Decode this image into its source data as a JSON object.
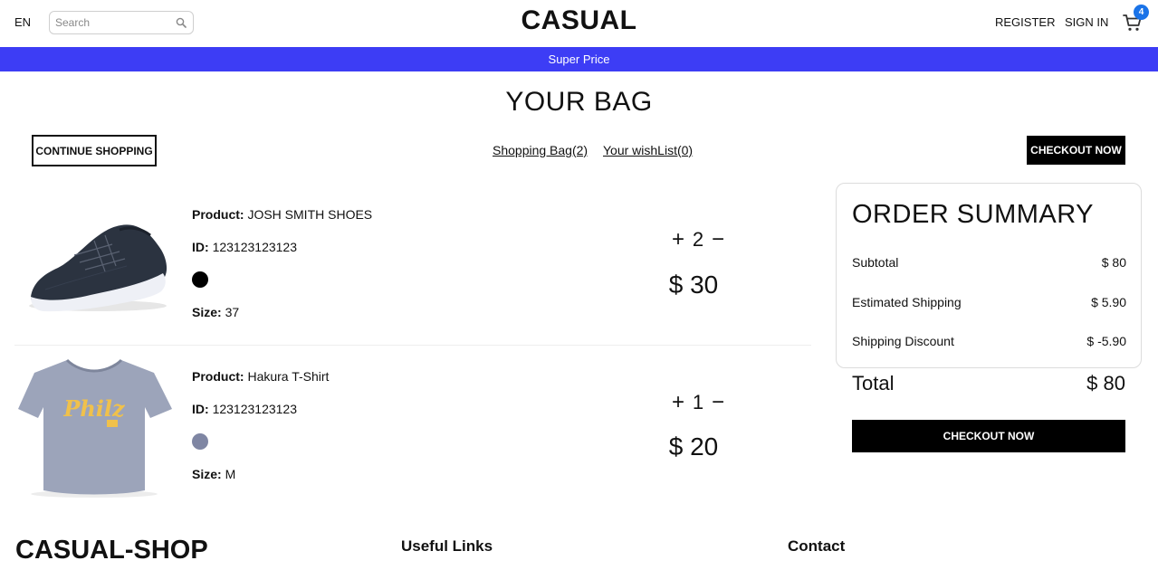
{
  "header": {
    "language": "EN",
    "search_placeholder": "Search",
    "logo": "CASUAL",
    "register": "REGISTER",
    "sign_in": "SIGN IN",
    "cart_count": "4"
  },
  "banner": {
    "text": "Super Price"
  },
  "page": {
    "title": "YOUR BAG",
    "continue_shopping": "CONTINUE SHOPPING",
    "shopping_bag_link": "Shopping Bag(2)",
    "wishlist_link": "Your wishList(0)",
    "checkout_top": "CHECKOUT NOW"
  },
  "labels": {
    "product": "Product:",
    "id": "ID:",
    "size": "Size:"
  },
  "products": [
    {
      "name": "JOSH SMITH SHOES",
      "id": "123123123123",
      "color": "#000000",
      "size": "37",
      "quantity": "2",
      "price": "$ 30",
      "image_icon": "sneaker-image"
    },
    {
      "name": "Hakura T-Shirt",
      "id": "123123123123",
      "color": "#7f86a3",
      "size": "M",
      "quantity": "1",
      "price": "$ 20",
      "image_icon": "tshirt-image",
      "shirt_print": "Philz"
    }
  ],
  "summary": {
    "title": "ORDER SUMMARY",
    "subtotal_label": "Subtotal",
    "subtotal_value": "$ 80",
    "shipping_label": "Estimated Shipping",
    "shipping_value": "$ 5.90",
    "discount_label": "Shipping Discount",
    "discount_value": "$ -5.90",
    "total_label": "Total",
    "total_value": "$ 80",
    "checkout": "CHECKOUT NOW"
  },
  "footer": {
    "brand": "CASUAL-SHOP",
    "useful_links": "Useful Links",
    "contact": "Contact"
  },
  "colors": {
    "banner": "#3d3df5",
    "badge": "#1a73e8",
    "button": "#000000"
  }
}
